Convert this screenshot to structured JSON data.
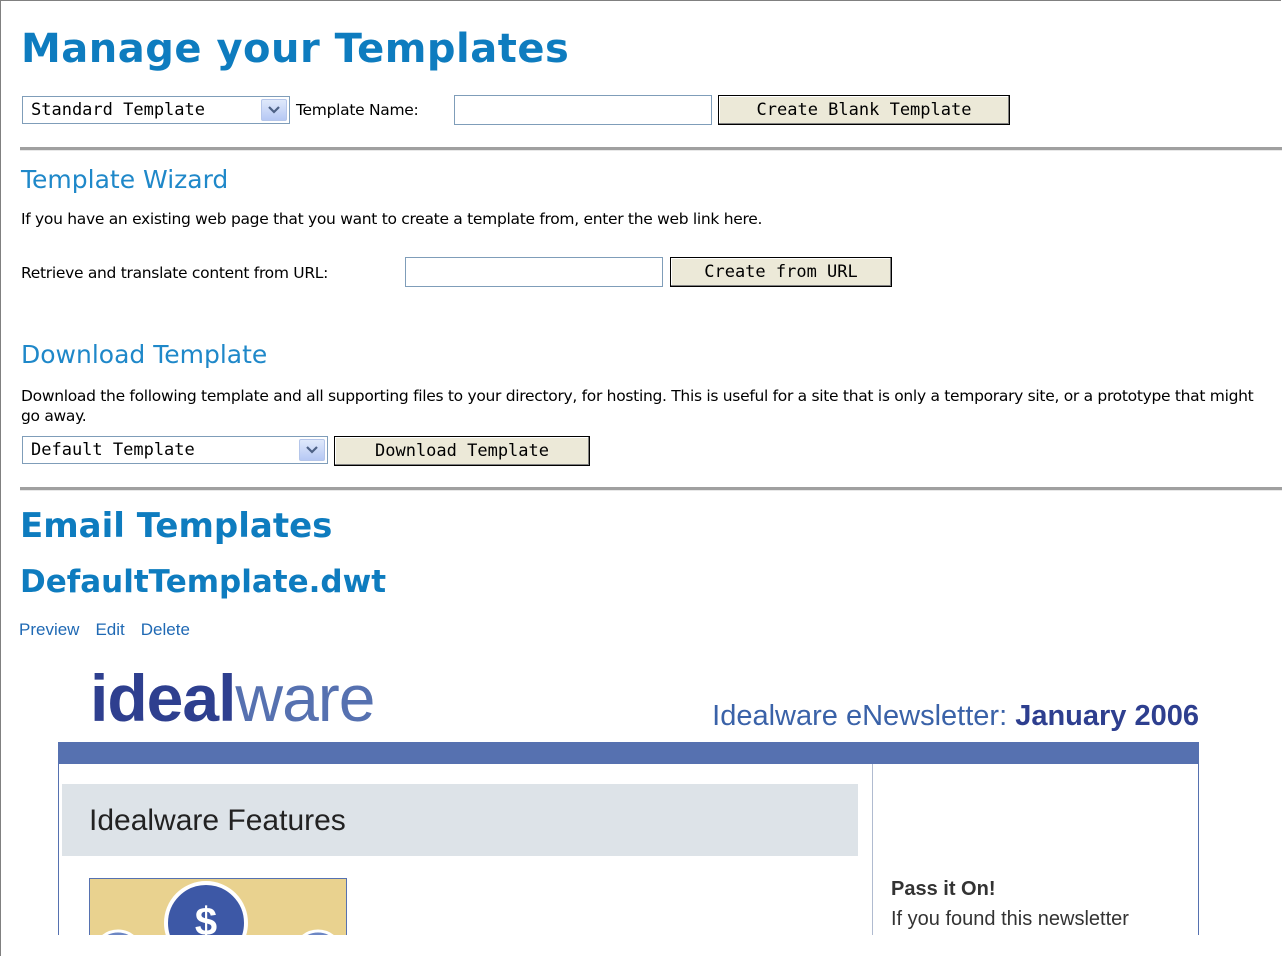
{
  "header": {
    "title": "Manage your Templates"
  },
  "create": {
    "template_type": "Standard Template",
    "name_label": "Template Name:",
    "name_value": "",
    "button": "Create Blank Template"
  },
  "wizard": {
    "title": "Template Wizard",
    "description": "If you have an existing web page that you want to create a template from, enter the web link here.",
    "url_label": "Retrieve and translate content from URL:",
    "url_value": "",
    "button": "Create from URL"
  },
  "download": {
    "title": "Download Template",
    "description": "Download the following template and all supporting files to your directory, for hosting. This is useful for a site that is only a temporary site, or a prototype that might go away.",
    "selected": "Default Template",
    "button": "Download Template"
  },
  "email": {
    "title": "Email Templates",
    "template_name": "DefaultTemplate.dwt",
    "actions": {
      "preview": "Preview",
      "edit": "Edit",
      "delete": "Delete"
    }
  },
  "preview": {
    "logo_bold": "ideal",
    "logo_light": "ware",
    "newsletter_prefix": "Idealware eNewsletter: ",
    "newsletter_date": "January 2006",
    "features_heading": "Idealware Features",
    "sidebar_heading": "Pass it On!",
    "sidebar_text": "If you found this newsletter",
    "colors": {
      "brand_dark": "#2e3f8f",
      "brand_bar": "#5671b0",
      "panel_gray": "#dde3e8",
      "thumb_bg": "#e9d28f"
    }
  }
}
